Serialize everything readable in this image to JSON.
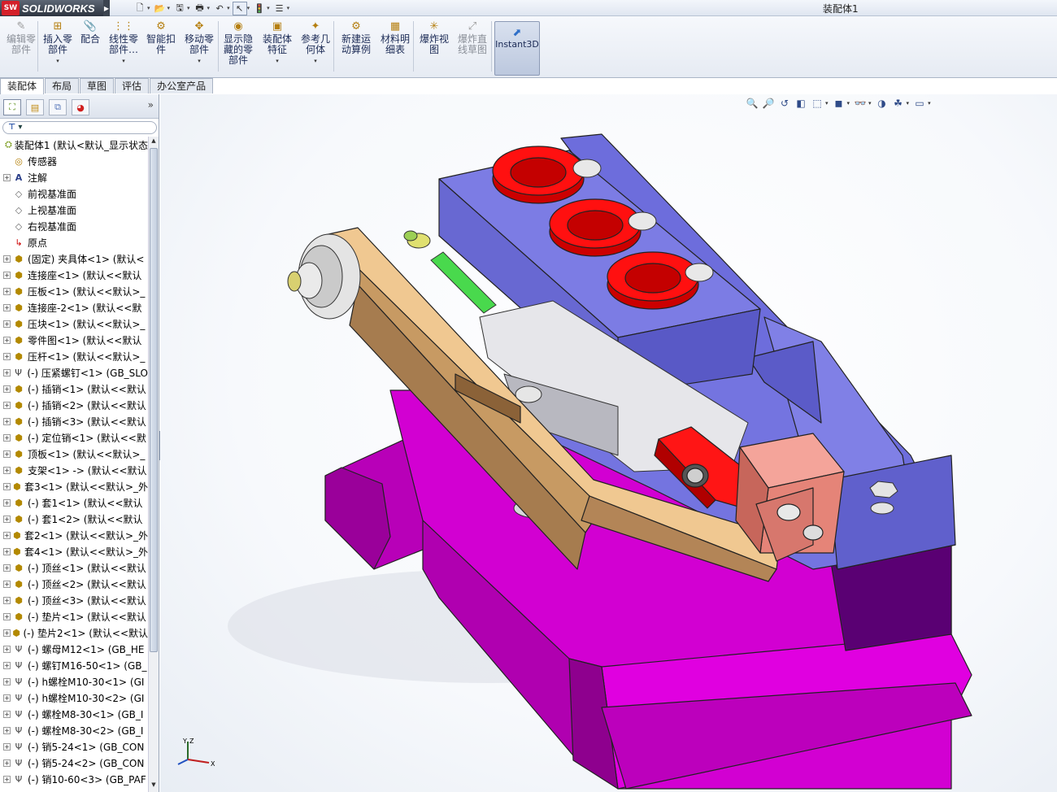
{
  "app": {
    "logo_badge": "SW",
    "logo_text": "SOLIDWORKS",
    "document_title": "装配体1"
  },
  "quick_access": [
    {
      "icon": "new-document-icon",
      "glyph": "🗋"
    },
    {
      "icon": "open-folder-icon",
      "glyph": "📂"
    },
    {
      "icon": "save-icon",
      "glyph": "🖫"
    },
    {
      "icon": "print-icon",
      "glyph": "🖶"
    },
    {
      "icon": "undo-icon",
      "glyph": "↶"
    },
    {
      "icon": "select-pointer-icon",
      "glyph": "↖"
    },
    {
      "icon": "rebuild-icon",
      "glyph": "🚦"
    },
    {
      "icon": "options-icon",
      "glyph": "☰"
    }
  ],
  "ribbon": {
    "buttons": [
      {
        "label": "编辑零\n部件",
        "icon": "edit-component-icon",
        "glyph": "✎",
        "disabled": true
      },
      {
        "label": "插入零\n部件",
        "icon": "insert-component-icon",
        "glyph": "⊞",
        "disabled": false,
        "dropdown": true
      },
      {
        "label": "配合",
        "icon": "mate-icon",
        "glyph": "📎",
        "disabled": false
      },
      {
        "label": "线性零\n部件…",
        "icon": "linear-pattern-icon",
        "glyph": "⋮⋮",
        "disabled": false,
        "dropdown": true
      },
      {
        "label": "智能扣\n件",
        "icon": "smart-fasteners-icon",
        "glyph": "⚙",
        "disabled": false
      },
      {
        "label": "移动零\n部件",
        "icon": "move-component-icon",
        "glyph": "✥",
        "disabled": false,
        "dropdown": true
      },
      {
        "label": "显示隐\n藏的零\n部件",
        "icon": "show-hidden-icon",
        "glyph": "◉",
        "disabled": false
      },
      {
        "label": "装配体\n特征",
        "icon": "assembly-features-icon",
        "glyph": "▣",
        "disabled": false,
        "dropdown": true
      },
      {
        "label": "参考几\n何体",
        "icon": "reference-geometry-icon",
        "glyph": "✦",
        "disabled": false,
        "dropdown": true
      },
      {
        "label": "新建运\n动算例",
        "icon": "motion-study-icon",
        "glyph": "⚙",
        "disabled": false
      },
      {
        "label": "材料明\n细表",
        "icon": "bom-icon",
        "glyph": "▦",
        "disabled": false
      },
      {
        "label": "爆炸视\n图",
        "icon": "exploded-view-icon",
        "glyph": "✳",
        "disabled": false
      },
      {
        "label": "爆炸直\n线草图",
        "icon": "explode-line-sketch-icon",
        "glyph": "⤢",
        "disabled": true
      }
    ],
    "instant3d": "Instant3D"
  },
  "tabs": [
    {
      "label": "装配体",
      "active": true
    },
    {
      "label": "布局",
      "active": false
    },
    {
      "label": "草图",
      "active": false
    },
    {
      "label": "评估",
      "active": false
    },
    {
      "label": "办公室产品",
      "active": false
    }
  ],
  "panel": {
    "tabs": [
      {
        "icon": "feature-manager-icon",
        "glyph": "⛶"
      },
      {
        "icon": "property-manager-icon",
        "glyph": "▤"
      },
      {
        "icon": "configuration-manager-icon",
        "glyph": "⧉"
      },
      {
        "icon": "display-manager-icon",
        "glyph": "◕"
      }
    ],
    "more": "»",
    "filter": "▾"
  },
  "tree": [
    {
      "label": "装配体1 (默认<默认_显示状态",
      "icon": "assembly-icon",
      "kind": "assy",
      "expander": false
    },
    {
      "label": "传感器",
      "icon": "sensor-icon",
      "kind": "sensor",
      "expander": false
    },
    {
      "label": "注解",
      "icon": "annotation-icon",
      "kind": "note",
      "expander": true
    },
    {
      "label": "前视基准面",
      "icon": "plane-icon",
      "kind": "plane",
      "expander": false
    },
    {
      "label": "上视基准面",
      "icon": "plane-icon",
      "kind": "plane",
      "expander": false
    },
    {
      "label": "右视基准面",
      "icon": "plane-icon",
      "kind": "plane",
      "expander": false
    },
    {
      "label": "原点",
      "icon": "origin-icon",
      "kind": "origin",
      "expander": false
    },
    {
      "label": "(固定) 夹具体<1> (默认<",
      "icon": "part-icon",
      "kind": "part",
      "expander": true
    },
    {
      "label": "连接座<1> (默认<<默认",
      "icon": "part-icon",
      "kind": "part",
      "expander": true
    },
    {
      "label": "压板<1> (默认<<默认>_",
      "icon": "part-icon",
      "kind": "part",
      "expander": true
    },
    {
      "label": "连接座-2<1> (默认<<默",
      "icon": "part-icon",
      "kind": "part",
      "expander": true
    },
    {
      "label": "压块<1> (默认<<默认>_",
      "icon": "part-icon",
      "kind": "part",
      "expander": true
    },
    {
      "label": "零件图<1> (默认<<默认",
      "icon": "part-icon",
      "kind": "part",
      "expander": true
    },
    {
      "label": "压杆<1> (默认<<默认>_",
      "icon": "part-icon",
      "kind": "part",
      "expander": true
    },
    {
      "label": "(-) 压紧螺钉<1> (GB_SLO",
      "icon": "screw-icon",
      "kind": "screw",
      "expander": true
    },
    {
      "label": "(-) 插销<1> (默认<<默认",
      "icon": "part-icon",
      "kind": "part",
      "expander": true
    },
    {
      "label": "(-) 插销<2> (默认<<默认",
      "icon": "part-icon",
      "kind": "part",
      "expander": true
    },
    {
      "label": "(-) 插销<3> (默认<<默认",
      "icon": "part-icon",
      "kind": "part",
      "expander": true
    },
    {
      "label": "(-) 定位销<1> (默认<<默",
      "icon": "part-icon",
      "kind": "part",
      "expander": true
    },
    {
      "label": "顶板<1> (默认<<默认>_",
      "icon": "part-icon",
      "kind": "part",
      "expander": true
    },
    {
      "label": "支架<1> -> (默认<<默认",
      "icon": "part-icon",
      "kind": "part",
      "expander": true
    },
    {
      "label": "套3<1> (默认<<默认>_外",
      "icon": "part-icon",
      "kind": "part",
      "expander": true
    },
    {
      "label": "(-) 套1<1> (默认<<默认",
      "icon": "part-icon",
      "kind": "part",
      "expander": true
    },
    {
      "label": "(-) 套1<2> (默认<<默认",
      "icon": "part-icon",
      "kind": "part",
      "expander": true
    },
    {
      "label": "套2<1> (默认<<默认>_外",
      "icon": "part-icon",
      "kind": "part",
      "expander": true
    },
    {
      "label": "套4<1> (默认<<默认>_外",
      "icon": "part-icon",
      "kind": "part",
      "expander": true
    },
    {
      "label": "(-) 顶丝<1> (默认<<默认",
      "icon": "part-icon",
      "kind": "part",
      "expander": true
    },
    {
      "label": "(-) 顶丝<2> (默认<<默认",
      "icon": "part-icon",
      "kind": "part",
      "expander": true
    },
    {
      "label": "(-) 顶丝<3> (默认<<默认",
      "icon": "part-icon",
      "kind": "part",
      "expander": true
    },
    {
      "label": "(-) 垫片<1> (默认<<默认",
      "icon": "part-icon",
      "kind": "part",
      "expander": true
    },
    {
      "label": "(-) 垫片2<1> (默认<<默认",
      "icon": "part-icon",
      "kind": "part",
      "expander": true
    },
    {
      "label": "(-) 螺母M12<1> (GB_HE",
      "icon": "screw-icon",
      "kind": "screw",
      "expander": true
    },
    {
      "label": "(-) 螺钉M16-50<1> (GB_",
      "icon": "screw-icon",
      "kind": "screw",
      "expander": true
    },
    {
      "label": "(-) h螺栓M10-30<1> (GI",
      "icon": "screw-icon",
      "kind": "screw",
      "expander": true
    },
    {
      "label": "(-) h螺栓M10-30<2> (GI",
      "icon": "screw-icon",
      "kind": "screw",
      "expander": true
    },
    {
      "label": "(-) 螺栓M8-30<1> (GB_I",
      "icon": "screw-icon",
      "kind": "screw",
      "expander": true
    },
    {
      "label": "(-) 螺栓M8-30<2> (GB_I",
      "icon": "screw-icon",
      "kind": "screw",
      "expander": true
    },
    {
      "label": "(-) 销5-24<1> (GB_CON",
      "icon": "screw-icon",
      "kind": "screw",
      "expander": true
    },
    {
      "label": "(-) 销5-24<2> (GB_CON",
      "icon": "screw-icon",
      "kind": "screw",
      "expander": true
    },
    {
      "label": "(-) 销10-60<3> (GB_PAF",
      "icon": "screw-icon",
      "kind": "screw",
      "expander": true
    }
  ],
  "view_toolbar": [
    {
      "icon": "zoom-to-fit-icon",
      "glyph": "🔍",
      "dropdown": false
    },
    {
      "icon": "zoom-to-area-icon",
      "glyph": "🔎",
      "dropdown": false
    },
    {
      "icon": "previous-view-icon",
      "glyph": "↺",
      "dropdown": false
    },
    {
      "icon": "section-view-icon",
      "glyph": "◧",
      "dropdown": false
    },
    {
      "icon": "view-orientation-icon",
      "glyph": "⬚",
      "dropdown": true
    },
    {
      "icon": "display-style-icon",
      "glyph": "◼",
      "dropdown": true
    },
    {
      "icon": "hide-show-items-icon",
      "glyph": "👓",
      "dropdown": true
    },
    {
      "icon": "edit-appearance-icon",
      "glyph": "◑",
      "dropdown": false
    },
    {
      "icon": "apply-scene-icon",
      "glyph": "☘",
      "dropdown": true
    },
    {
      "icon": "view-settings-icon",
      "glyph": "▭",
      "dropdown": true
    }
  ],
  "triad": {
    "x": "X",
    "y": "Y",
    "z": "Z"
  },
  "colors": {
    "base_magenta": "#cc00cc",
    "body_blue": "#6a6ad8",
    "clamp_red": "#e00000",
    "lever_tan": "#d9aa78",
    "block_salmon": "#e88a7f"
  }
}
